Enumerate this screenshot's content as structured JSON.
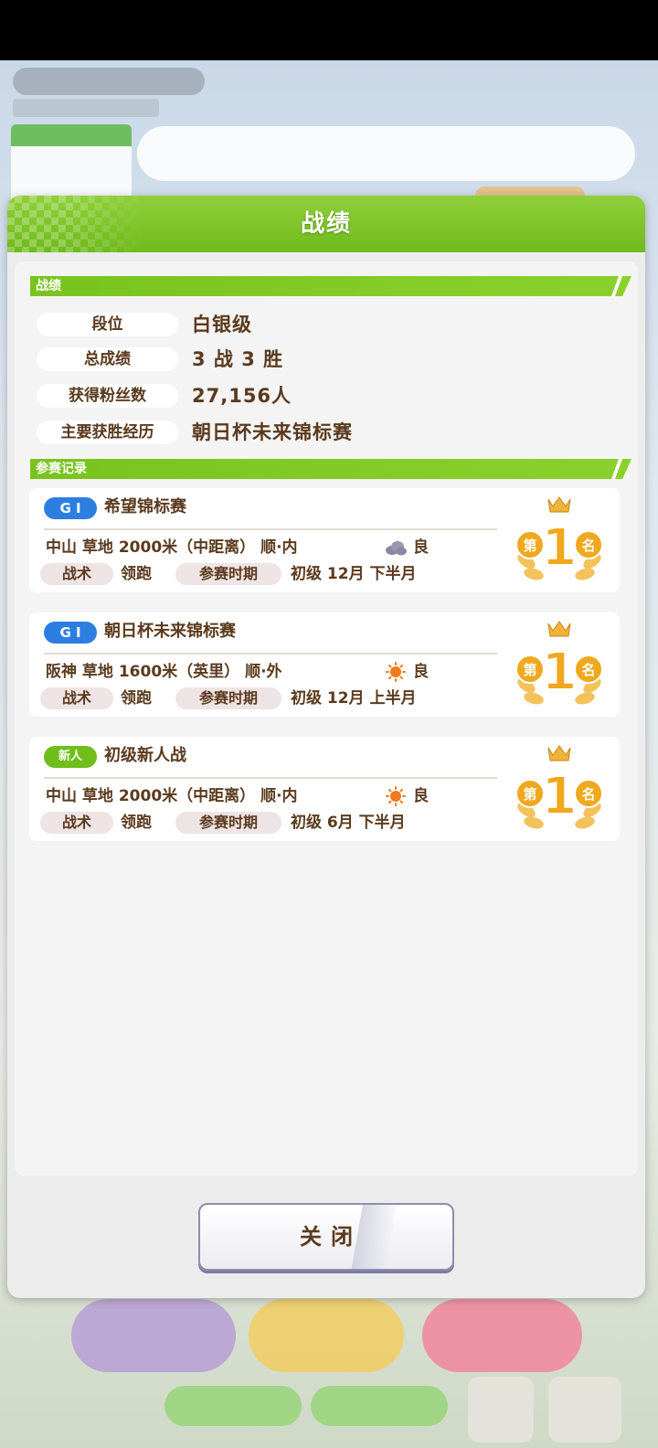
{
  "dialog": {
    "title": "战绩"
  },
  "record": {
    "section_label": "战绩",
    "stats": [
      {
        "label": "段位",
        "value": "白银级"
      },
      {
        "label": "总成绩",
        "value": "3 战 3 胜"
      },
      {
        "label": "获得粉丝数",
        "value": "27,156人"
      },
      {
        "label": "主要获胜经历",
        "value": "朝日杯未来锦标赛"
      }
    ]
  },
  "races": {
    "section_label": "参赛记录",
    "tactic_label": "战术",
    "period_label": "参赛时期",
    "items": [
      {
        "grade": "G I",
        "name": "希望锦标赛",
        "course": "中山  草地  2000米（中距离）  顺·内",
        "weather": "cloudy-icon",
        "condition": "良",
        "tactic": "领跑",
        "period": "初级  12月  下半月",
        "placing": "第1名"
      },
      {
        "grade": "G I",
        "name": "朝日杯未来锦标赛",
        "course": "阪神  草地  1600米（英里）  顺·外",
        "weather": "sunny-icon",
        "condition": "良",
        "tactic": "领跑",
        "period": "初级  12月  上半月",
        "placing": "第1名"
      },
      {
        "grade": "新人",
        "name": "初级新人战",
        "course": "中山  草地  2000米（中距离）  顺·内",
        "weather": "sunny-icon",
        "condition": "良",
        "tactic": "领跑",
        "period": "初级  6月  下半月",
        "placing": "第1名"
      }
    ]
  },
  "footer": {
    "close_label": "关闭"
  },
  "colors": {
    "header_green": "#7bc424",
    "text_brown": "#5b3a1e",
    "grade_blue": "#2c7fe0",
    "medal_gold": "#f0a81e"
  }
}
